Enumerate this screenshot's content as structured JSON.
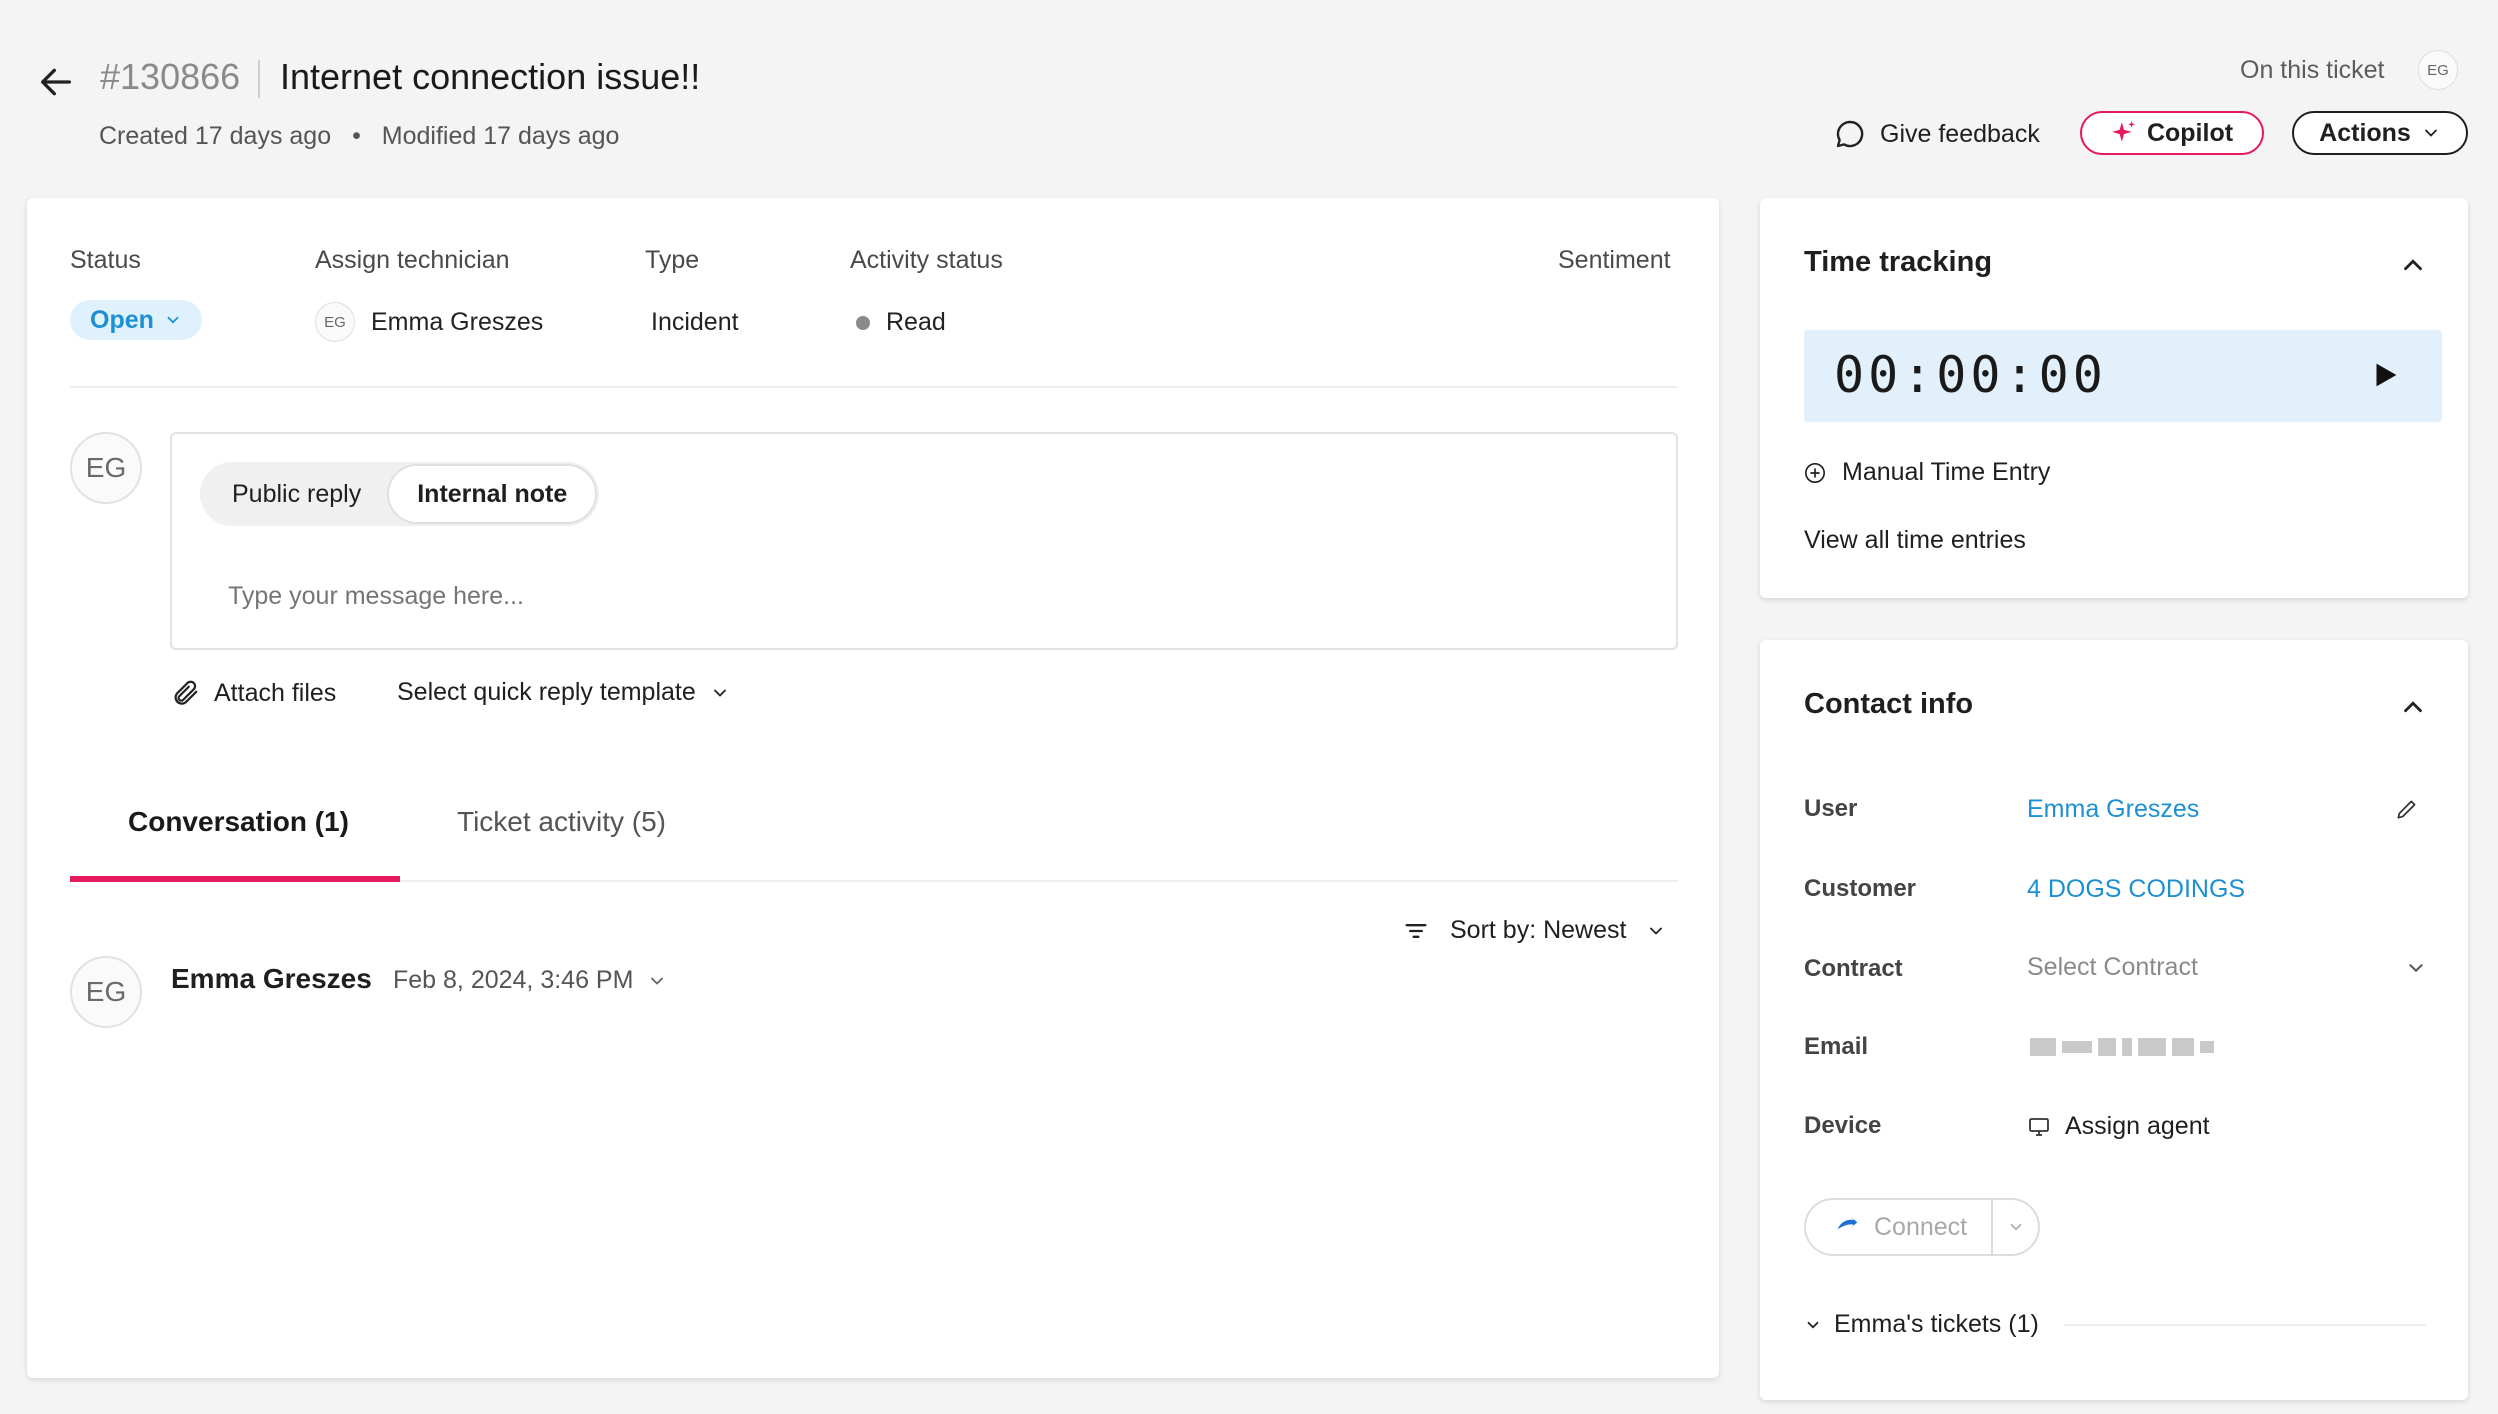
{
  "header": {
    "ticket_number": "#130866",
    "title": "Internet connection issue!!",
    "created": "Created 17 days ago",
    "meta_sep": "•",
    "modified": "Modified 17 days ago",
    "on_this_ticket": "On this ticket",
    "on_ticket_avatar": "EG",
    "give_feedback": "Give feedback",
    "copilot": "Copilot",
    "actions": "Actions"
  },
  "status_bar": {
    "status_label": "Status",
    "status_value": "Open",
    "technician_label": "Assign technician",
    "technician_avatar": "EG",
    "technician_name": "Emma Greszes",
    "type_label": "Type",
    "type_value": "Incident",
    "activity_label": "Activity status",
    "activity_value": "Read",
    "sentiment_label": "Sentiment"
  },
  "composer": {
    "avatar": "EG",
    "tabs": [
      "Public reply",
      "Internal note"
    ],
    "active_tab": "Internal note",
    "placeholder": "Type your message here...",
    "attach": "Attach files",
    "quick_reply": "Select quick reply template"
  },
  "tabs": {
    "conversation": "Conversation (1)",
    "activity": "Ticket activity (5)",
    "sort": "Sort by: Newest"
  },
  "message": {
    "avatar": "EG",
    "author": "Emma Greszes",
    "date": "Feb 8, 2024, 3:46 PM"
  },
  "time_tracking": {
    "title": "Time tracking",
    "timer": "00:00:00",
    "manual": "Manual Time Entry",
    "view_all": "View all time entries"
  },
  "contact": {
    "title": "Contact info",
    "user_label": "User",
    "user_value": "Emma Greszes",
    "customer_label": "Customer",
    "customer_value": "4 DOGS CODINGS",
    "contract_label": "Contract",
    "contract_placeholder": "Select Contract",
    "email_label": "Email",
    "device_label": "Device",
    "device_value": "Assign agent",
    "connect": "Connect",
    "tickets": "Emma's tickets (1)"
  },
  "colors": {
    "accent_pink": "#e5195e",
    "link_blue": "#1d8fd3",
    "status_bg": "#dff1fc",
    "timer_bg": "#e1f0fa"
  }
}
